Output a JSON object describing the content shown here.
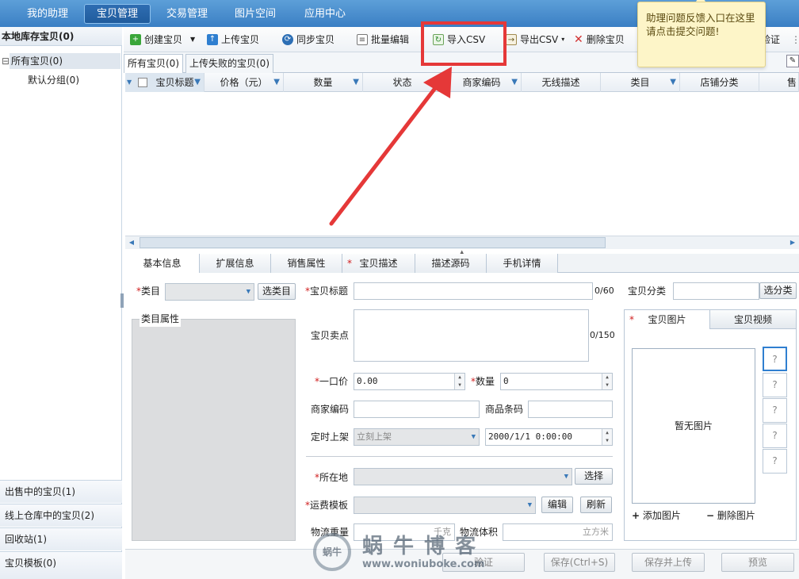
{
  "topnav": {
    "tabs": [
      "我的助理",
      "宝贝管理",
      "交易管理",
      "图片空间",
      "应用中心"
    ],
    "active": 1
  },
  "sidebar": {
    "header": "本地库存宝贝(0)",
    "tree": {
      "toggle": "⊟",
      "all": "所有宝贝(0)",
      "default_group": "默认分组(0)"
    },
    "bottom_items": [
      "出售中的宝贝(1)",
      "线上仓库中的宝贝(2)",
      "回收站(1)",
      "宝贝模板(0)"
    ]
  },
  "toolbar": {
    "create": "创建宝贝",
    "upload": "上传宝贝",
    "sync": "同步宝贝",
    "batch_edit": "批量编辑",
    "import_csv": "导入CSV",
    "export_csv": "导出CSV",
    "delete": "删除宝贝",
    "verify": "验证"
  },
  "list_tabs": [
    "所有宝贝(0)",
    "上传失败的宝贝(0)"
  ],
  "grid_columns": [
    "宝贝标题",
    "价格（元）",
    "数量",
    "状态",
    "商家编码",
    "无线描述",
    "类目",
    "店铺分类",
    "售"
  ],
  "form_tabs": [
    "基本信息",
    "扩展信息",
    "销售属性",
    "宝贝描述",
    "描述源码",
    "手机详情"
  ],
  "form": {
    "category_label": "类目",
    "category_btn": "选类目",
    "category_props": "类目属性",
    "title_label": "宝贝标题",
    "title_count": "0/60",
    "selling_label": "宝贝卖点",
    "selling_count": "0/150",
    "price_label": "一口价",
    "price_value": "0.00",
    "qty_label": "数量",
    "qty_value": "0",
    "merchant_code_label": "商家编码",
    "barcode_label": "商品条码",
    "schedule_label": "定时上架",
    "schedule_value": "立刻上架",
    "schedule_date": "2000/1/1 0:00:00",
    "location_label": "所在地",
    "location_btn": "选择",
    "shipping_label": "运费模板",
    "edit_btn": "编辑",
    "refresh_btn": "刷新",
    "weight_label": "物流重量",
    "weight_unit": "千克",
    "volume_label": "物流体积",
    "volume_unit": "立方米",
    "shop_cat_label": "宝贝分类",
    "shop_cat_btn": "选分类"
  },
  "media": {
    "tab_image": "宝贝图片",
    "tab_video": "宝贝视频",
    "no_image": "暂无图片",
    "add_image": "添加图片",
    "remove_image": "删除图片",
    "thumb_placeholder": "?"
  },
  "bottom_buttons": [
    "验证",
    "保存(Ctrl+S)",
    "保存并上传",
    "预览"
  ],
  "tooltip": "助理问题反馈入口在这里请点击提交问题!",
  "watermark": {
    "brand": "蜗 牛 博 客",
    "url": "www.woniuboke.com",
    "logo_text": "蜗牛"
  },
  "colors": {
    "highlight": "#e53838",
    "nav": "#3a7fc4",
    "required": "#d02020"
  }
}
